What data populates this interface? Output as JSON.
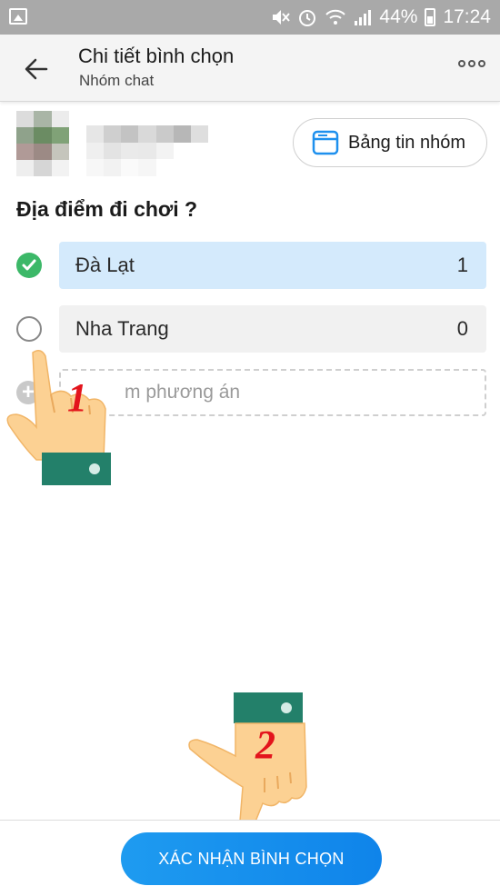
{
  "status_bar": {
    "battery_percent": "44%",
    "time": "17:24",
    "icons": [
      "image-icon",
      "mute-icon",
      "alarm-icon",
      "wifi-icon",
      "signal-icon",
      "battery-icon"
    ]
  },
  "header": {
    "title": "Chi tiết bình chọn",
    "subtitle": "Nhóm chat"
  },
  "group": {
    "board_button_label": "Bảng tin nhóm"
  },
  "poll": {
    "question": "Địa điểm đi chơi ?",
    "options": [
      {
        "label": "Đà Lạt",
        "votes": "1",
        "selected": true
      },
      {
        "label": "Nha Trang",
        "votes": "0",
        "selected": false
      }
    ],
    "add_option_text": "m phương án"
  },
  "annotations": {
    "step1": "1",
    "step2": "2"
  },
  "footer": {
    "confirm_label": "XÁC NHẬN BÌNH CHỌN"
  },
  "colors": {
    "accent": "#1692ee",
    "selected_option_bg": "#d4eafc",
    "check_green": "#3cb868",
    "status_bar": "#a9a9a9",
    "step_number": "#e3141c",
    "cuff_green": "#23806a",
    "hand_skin": "#fcd193"
  }
}
